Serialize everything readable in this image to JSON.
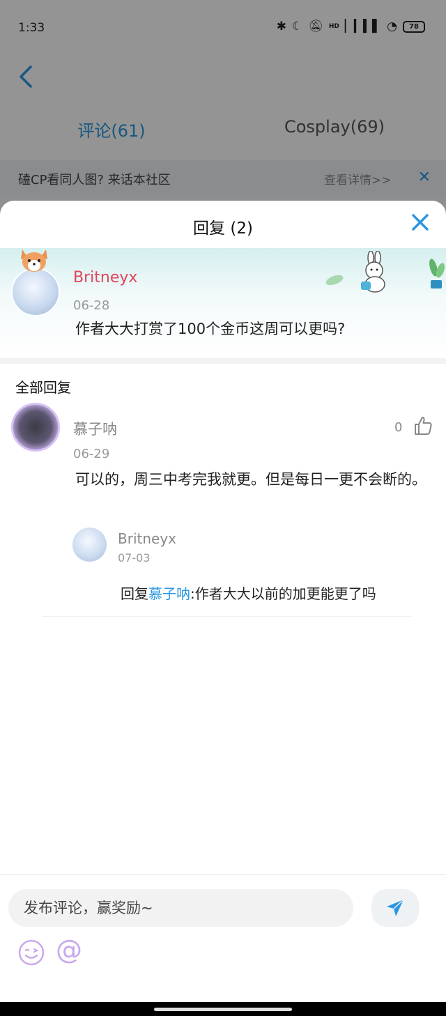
{
  "status_bar": {
    "time": "1:33",
    "battery": "78",
    "network": "HD"
  },
  "nav": {
    "tabs": [
      {
        "label": "评论(61)",
        "active": true
      },
      {
        "label": "Cosplay(69)",
        "active": false
      }
    ]
  },
  "banner": {
    "text": "磕CP看同人图? 来话本社区",
    "link": "查看详情>>"
  },
  "sheet": {
    "title": "回复 (2)",
    "original_comment": {
      "author": "Britneyx",
      "date": "06-28",
      "text": "作者大大打赏了100个金币这周可以更吗?"
    },
    "section_title": "全部回复",
    "reply": {
      "author": "慕子呐",
      "date": "06-29",
      "likes": "0",
      "text": "可以的，周三中考完我就更。但是每日一更不会断的。"
    },
    "sub_reply": {
      "author": "Britneyx",
      "date": "07-03",
      "prefix": "回复",
      "mention": "慕子呐",
      "text": ":作者大大以前的加更能更了吗"
    }
  },
  "input": {
    "placeholder": "发布评论，赢奖励~"
  },
  "colors": {
    "accent": "#2a97e0",
    "author_highlight": "#e0455a",
    "emoji_purple": "#c9a8ec"
  }
}
